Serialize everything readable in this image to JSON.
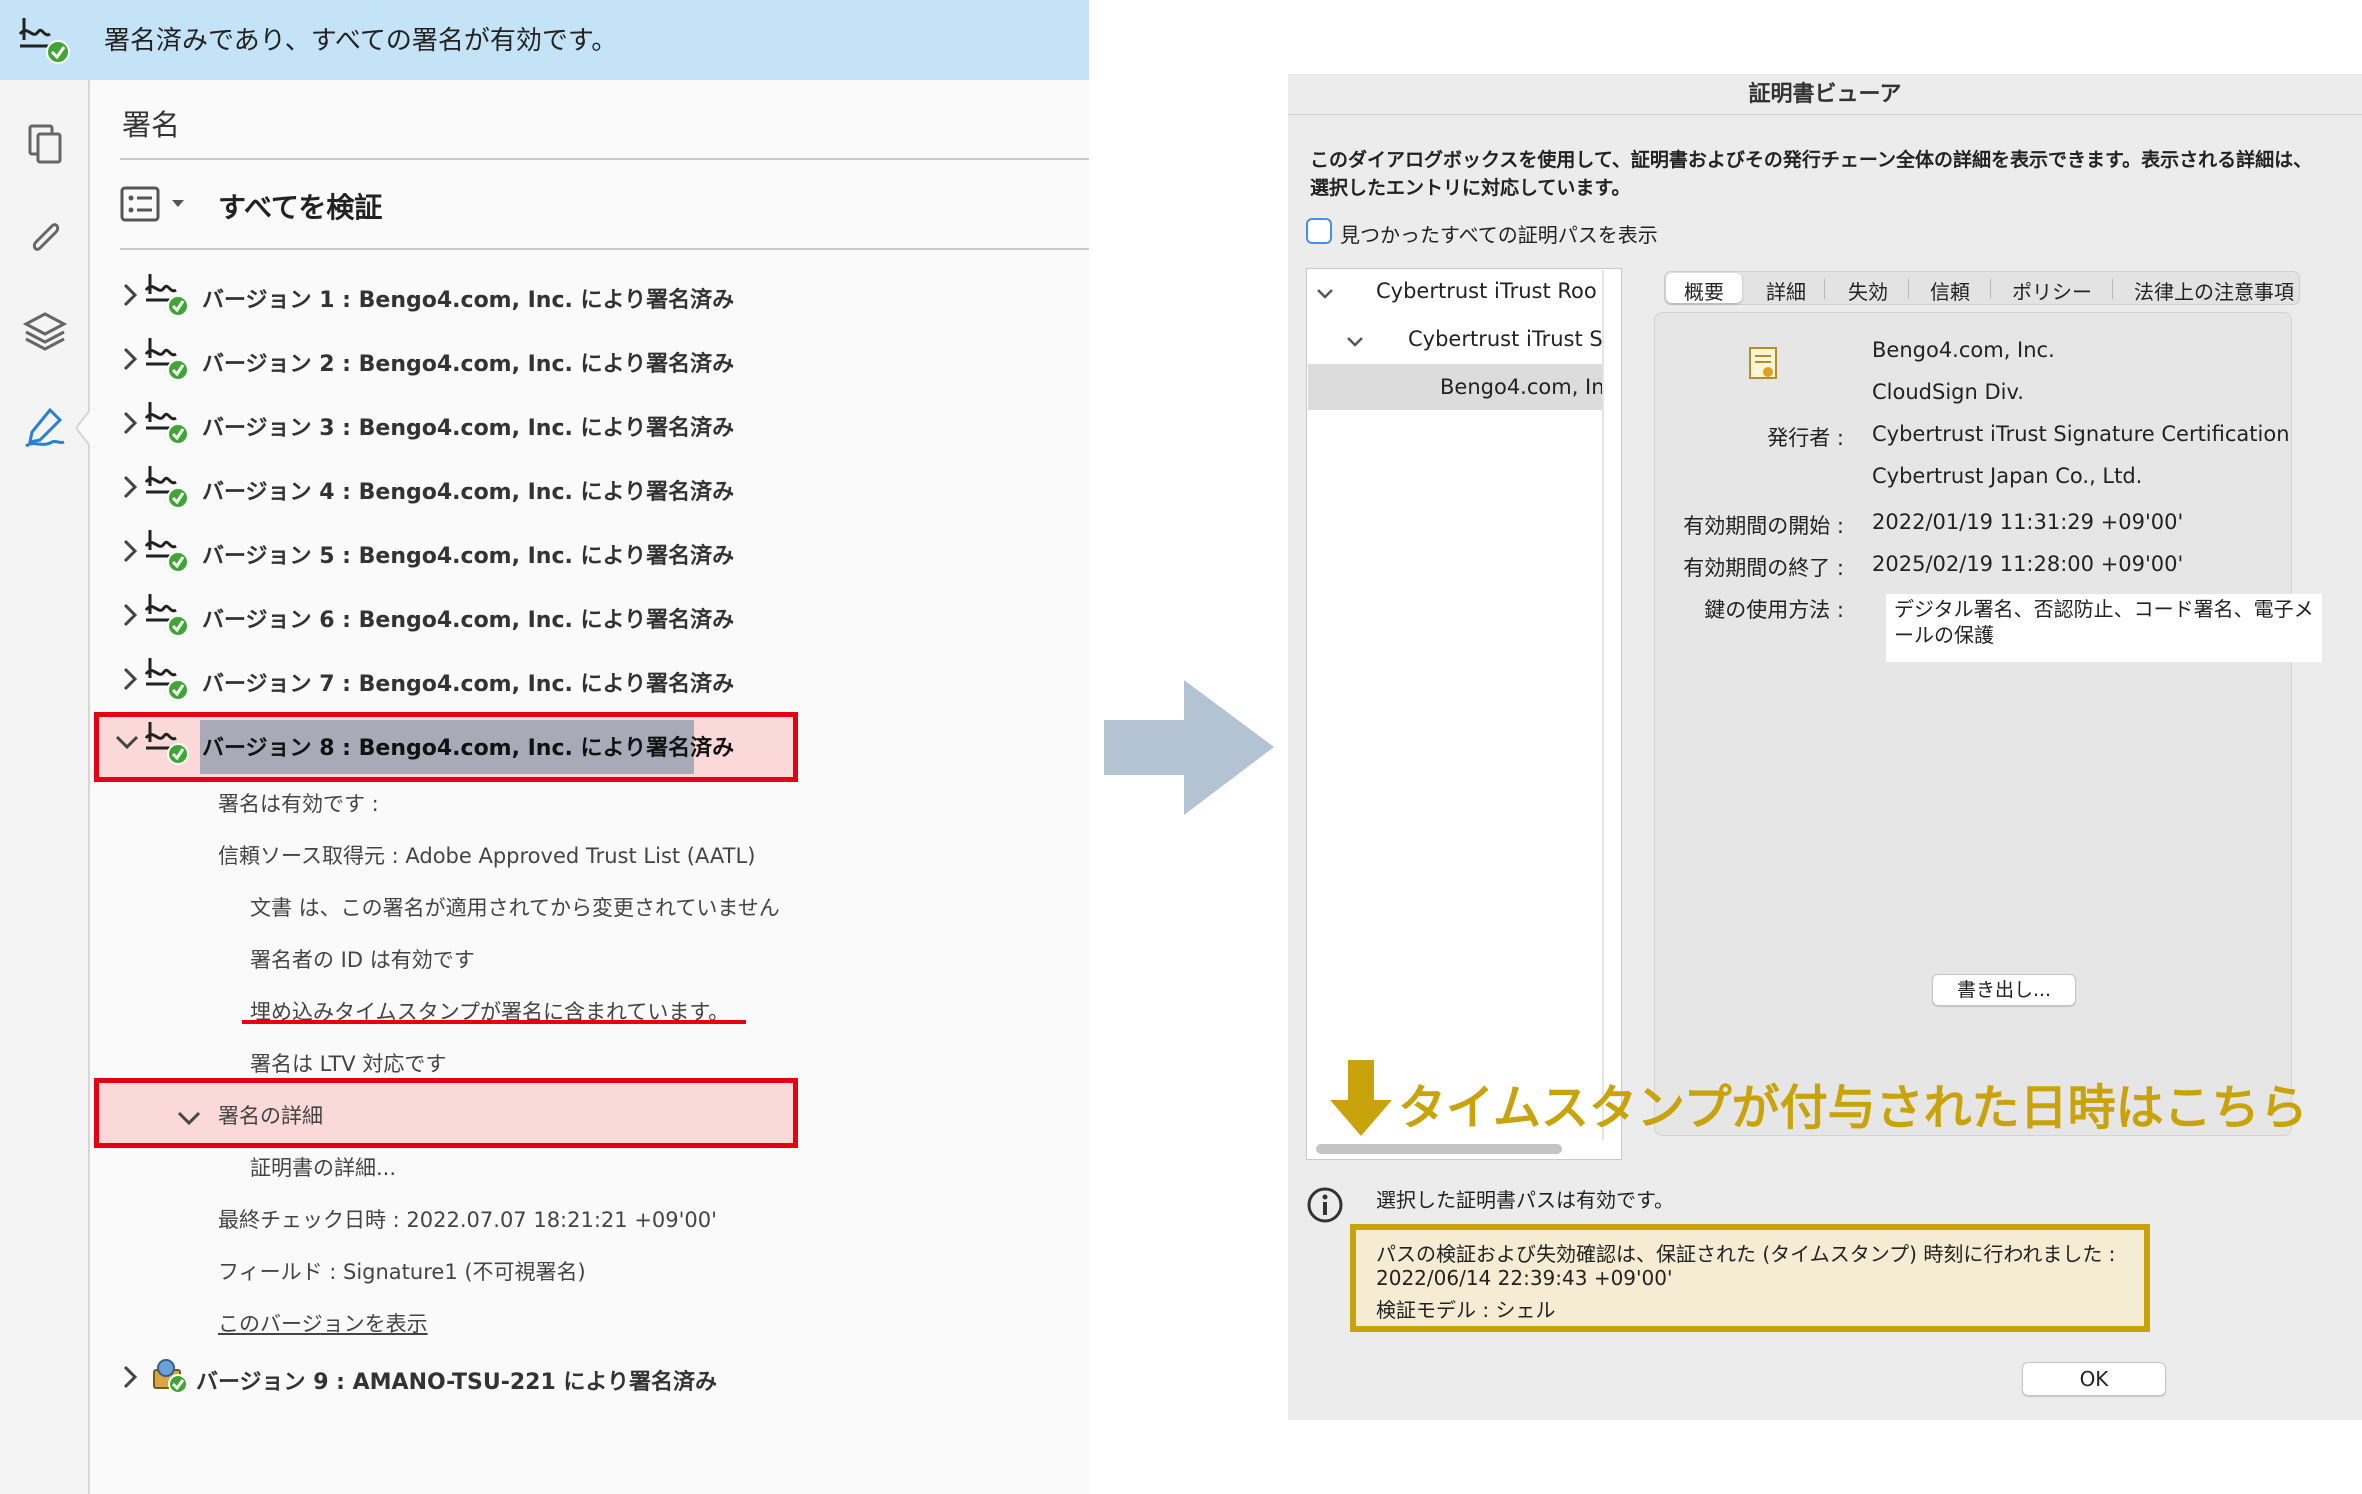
{
  "banner": {
    "text": "署名済みであり、すべての署名が有効です。"
  },
  "panel": {
    "title": "署名",
    "verify_all_label": "すべてを検証"
  },
  "versions": [
    {
      "label": "バージョン 1 : Bengo4.com, Inc. により署名済み"
    },
    {
      "label": "バージョン 2 : Bengo4.com, Inc. により署名済み"
    },
    {
      "label": "バージョン 3 : Bengo4.com, Inc. により署名済み"
    },
    {
      "label": "バージョン 4 : Bengo4.com, Inc. により署名済み"
    },
    {
      "label": "バージョン 5 : Bengo4.com, Inc. により署名済み"
    },
    {
      "label": "バージョン 6 : Bengo4.com, Inc. により署名済み"
    },
    {
      "label": "バージョン 7 : Bengo4.com, Inc. により署名済み"
    },
    {
      "label": "バージョン 8 : Bengo4.com, Inc. により署名済み"
    },
    {
      "label": "バージョン 9 : AMANO-TSU-221 により署名済み"
    }
  ],
  "v8_details": {
    "valid": "署名は有効です :",
    "trust_source": "信頼ソース取得元 : Adobe Approved Trust List (AATL)",
    "unchanged": "文書 は、この署名が適用されてから変更されていません",
    "id_valid": "署名者の ID は有効です",
    "timestamp": "埋め込みタイムスタンプが署名に含まれています。",
    "ltv": "署名は LTV 対応です",
    "details_header": "署名の詳細",
    "cert_details": "証明書の詳細...",
    "last_checked": "最終チェック日時 : 2022.07.07 18:21:21 +09'00'",
    "field": "フィールド : Signature1 (不可視署名)",
    "view_version": "このバージョンを表示"
  },
  "dialog": {
    "title": "証明書ビューア",
    "description": "このダイアログボックスを使用して、証明書およびその発行チェーン全体の詳細を表示できます。表示される詳細は、選択したエントリに対応しています。",
    "show_all_paths_label": "見つかったすべての証明パスを表示",
    "tree": [
      "Cybertrust iTrust Roo",
      "Cybertrust iTrust S",
      "Bengo4.com, In"
    ],
    "tabs": [
      "概要",
      "詳細",
      "失効",
      "信頼",
      "ポリシー",
      "法律上の注意事項"
    ],
    "summary": {
      "subject_line1": "Bengo4.com, Inc.",
      "subject_line2": "CloudSign Div.",
      "issuer_key": "発行者 :",
      "issuer_line1": "Cybertrust iTrust Signature Certification",
      "issuer_line2": "Cybertrust Japan Co., Ltd.",
      "valid_from_key": "有効期間の開始 :",
      "valid_from": "2022/01/19 11:31:29 +09'00'",
      "valid_to_key": "有効期間の終了 :",
      "valid_to": "2025/02/19 11:28:00 +09'00'",
      "key_usage_key": "鍵の使用方法 :",
      "key_usage": "デジタル署名、否認防止、コード署名、電子メールの保護"
    },
    "export_label": "書き出し...",
    "annotation": "タイムスタンプが付与された日時はこちら",
    "status": "選択した証明書パスは有効です。",
    "validation_line1": "パスの検証および失効確認は、保証された (タイムスタンプ) 時刻に行われました :",
    "validation_line2": "2022/06/14 22:39:43 +09'00'",
    "validation_line3": "検証モデル : シェル",
    "ok_label": "OK"
  },
  "colors": {
    "banner_bg": "#c4e3f7",
    "highlight_red": "#e50012",
    "annotation_gold": "#c9a30c",
    "check_green": "#3fa535",
    "arrow_blue": "#b3c3d3"
  },
  "icons": [
    "signature-check-icon",
    "pages-icon",
    "attachment-icon",
    "layers-icon",
    "pen-signature-icon",
    "chevron-right-icon",
    "chevron-down-icon",
    "certificate-icon",
    "info-icon",
    "down-arrow-icon",
    "right-arrow-icon"
  ]
}
